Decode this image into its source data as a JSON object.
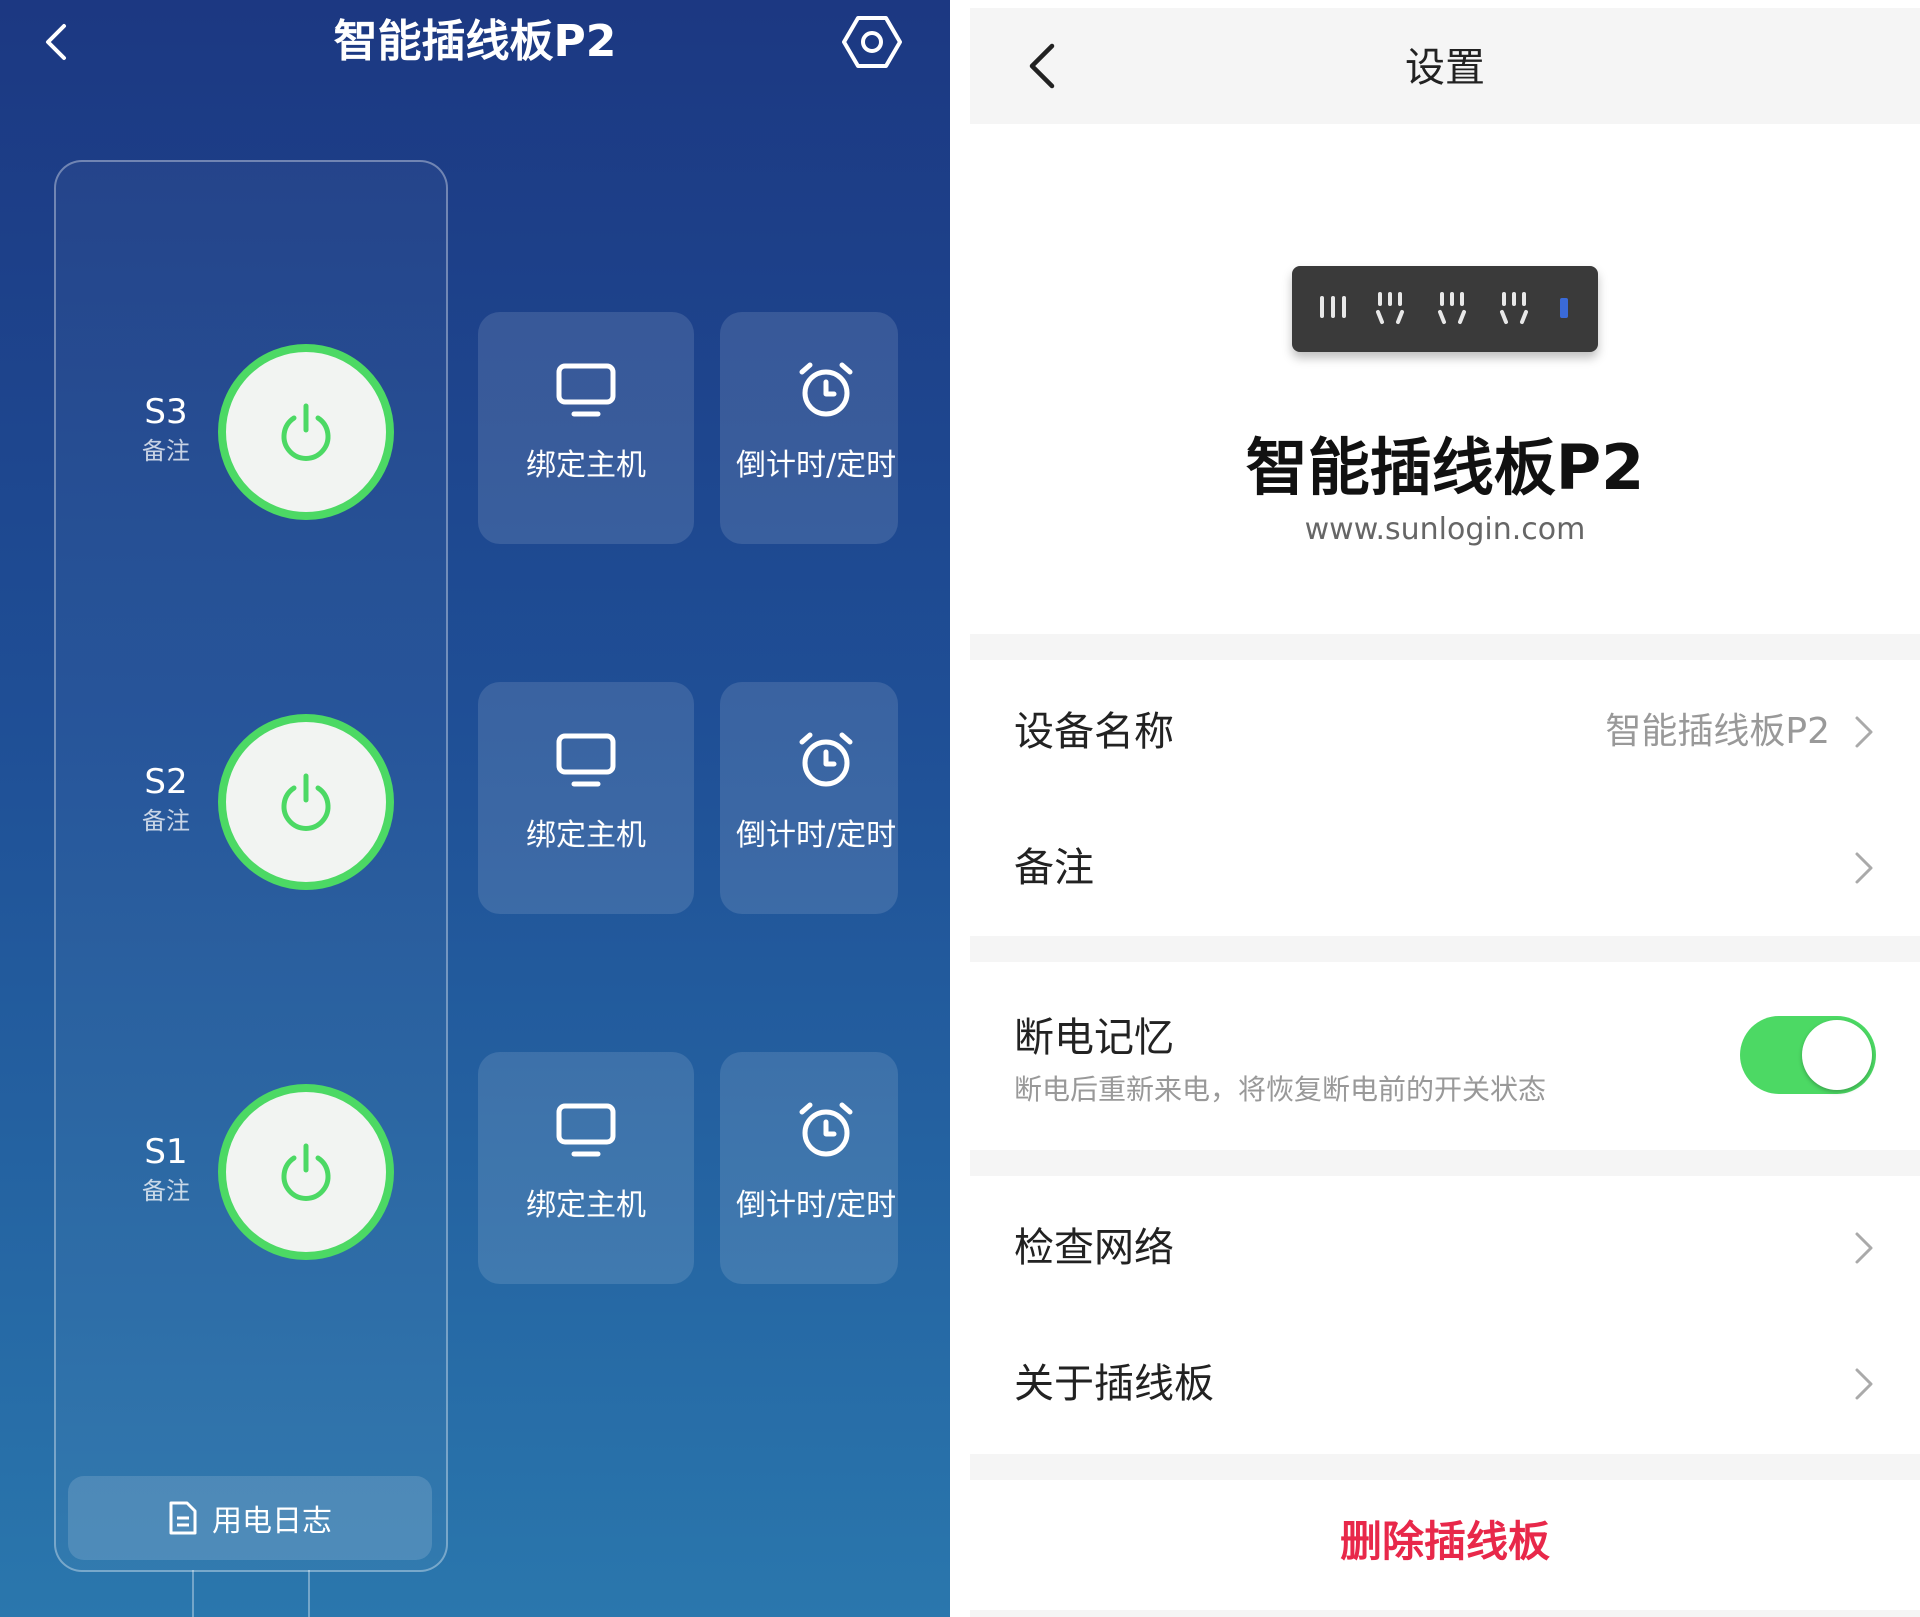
{
  "left_panel": {
    "title": "智能插线板P2",
    "sockets": [
      {
        "name": "S3",
        "note": "备注",
        "bind_label": "绑定主机",
        "timer_label": "倒计时/定时"
      },
      {
        "name": "S2",
        "note": "备注",
        "bind_label": "绑定主机",
        "timer_label": "倒计时/定时"
      },
      {
        "name": "S1",
        "note": "备注",
        "bind_label": "绑定主机",
        "timer_label": "倒计时/定时"
      }
    ],
    "log_label": "用电日志",
    "colors": {
      "accent": "#4cd964",
      "background_top": "#1c3882",
      "background_bottom": "#2a77ad"
    }
  },
  "right_panel": {
    "title": "设置",
    "device_name": "智能插线板P2",
    "website": "www.sunlogin.com",
    "rows": {
      "device_name_label": "设备名称",
      "device_name_value": "智能插线板P2",
      "note_label": "备注",
      "power_memory_label": "断电记忆",
      "power_memory_desc": "断电后重新来电，将恢复断电前的开关状态",
      "power_memory_on": true,
      "check_network_label": "检查网络",
      "about_label": "关于插线板"
    },
    "delete_label": "删除插线板",
    "colors": {
      "toggle_on": "#4cd964",
      "danger": "#e8284a"
    }
  }
}
